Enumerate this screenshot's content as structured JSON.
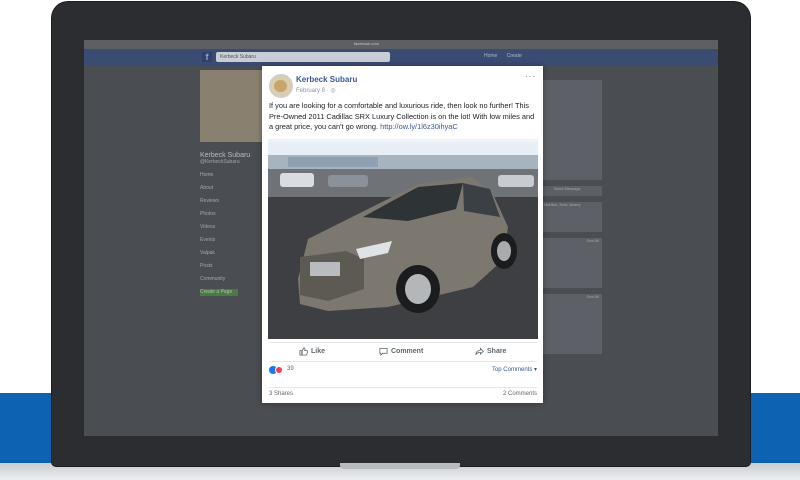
{
  "browser": {
    "url_text": "facebook.com"
  },
  "facebook": {
    "logo": "f",
    "search_value": "Kerbeck Subaru",
    "nav": [
      "Home",
      "Create"
    ]
  },
  "page_sidebar": {
    "name": "Kerbeck Subaru",
    "handle": "@KerbeckSubaru",
    "nav_items": [
      "Home",
      "About",
      "Reviews",
      "Photos",
      "Videos",
      "Events",
      "Valpak",
      "Posts",
      "Community"
    ],
    "create_button": "Create a Page"
  },
  "right_sidebar": {
    "send_message": "Send Message",
    "location": "Marlton, New Jersey",
    "see_all_1": "See All",
    "see_all_2": "See All"
  },
  "post": {
    "page_name": "Kerbeck Subaru",
    "date": "February 8 · ",
    "text_before_link": "If you are looking for a comfortable and luxurious ride, then look no further! This Pre-Owned 2011 Cadillac SRX Luxury Collection is on the lot! With low miles and a great price, you can't go wrong. ",
    "link": "http://ow.ly/1l6z30ihyaC",
    "more": "···",
    "actions": {
      "like": "Like",
      "comment": "Comment",
      "share": "Share"
    },
    "reactions_count": "39",
    "top_comments": "Top Comments ▾",
    "shares": "3 Shares",
    "comments": "2 Comments"
  },
  "colors": {
    "facebook_blue": "#385898",
    "like_blue": "#1877f2",
    "love_red": "#f33e58",
    "band_blue": "#0d63b2"
  }
}
